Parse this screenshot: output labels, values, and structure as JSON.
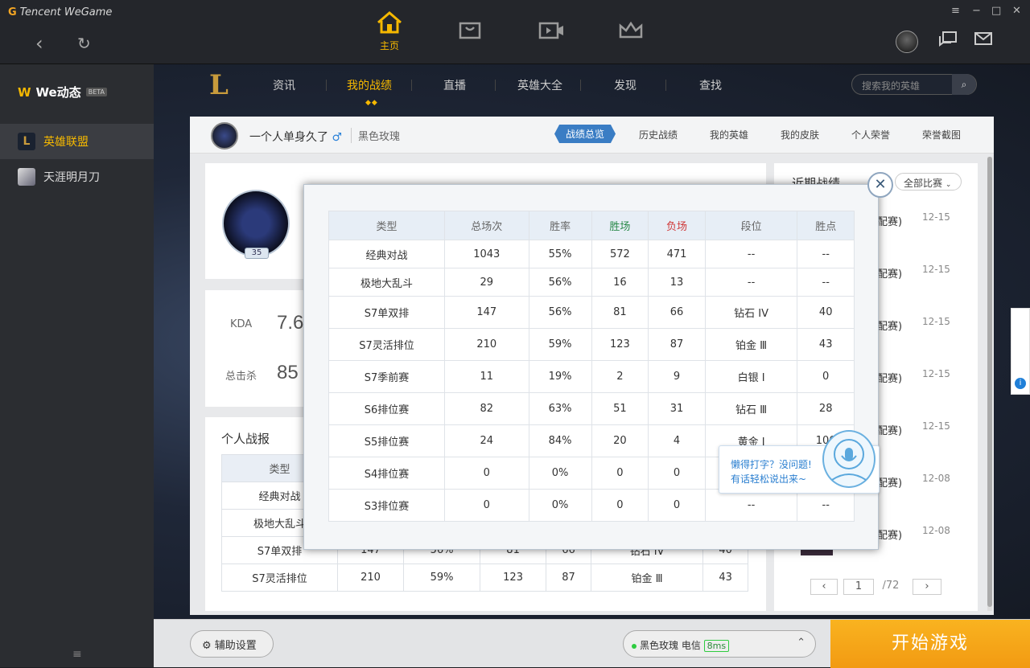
{
  "window": {
    "brand": "Tencent WeGame",
    "controls": [
      "≡",
      "−",
      "□",
      "✕"
    ]
  },
  "topnav": {
    "home": "主页"
  },
  "sidebar": {
    "title": "We动态",
    "beta": "BETA",
    "items": [
      {
        "label": "英雄联盟"
      },
      {
        "label": "天涯明月刀"
      }
    ],
    "menu": "≡"
  },
  "lolnav": {
    "items": [
      "资讯",
      "我的战绩",
      "直播",
      "英雄大全",
      "发现",
      "查找"
    ],
    "search_placeholder": "搜索我的英雄"
  },
  "profile": {
    "name": "一个人单身久了",
    "gender": "♂",
    "server": "黑色玫瑰",
    "level": "35",
    "tabs": [
      "战绩总览",
      "历史战绩",
      "我的英雄",
      "我的皮肤",
      "个人荣誉",
      "荣誉截图"
    ]
  },
  "stats": {
    "kda_label": "KDA",
    "kda_value": "7.6",
    "kills_label": "总击杀",
    "kills_value": "85"
  },
  "report": {
    "title": "个人战报",
    "headers": [
      "类型"
    ],
    "rows": [
      {
        "type": "经典对战"
      },
      {
        "type": "极地大乱斗"
      },
      {
        "type": "S7单双排",
        "cells": [
          "147",
          "56%",
          "81",
          "66",
          "钻石 IV",
          "40"
        ]
      },
      {
        "type": "S7灵活排位",
        "cells": [
          "210",
          "59%",
          "123",
          "87",
          "铂金 Ⅲ",
          "43"
        ]
      }
    ]
  },
  "modal": {
    "close": "✕",
    "headers": [
      "类型",
      "总场次",
      "胜率",
      "胜场",
      "负场",
      "段位",
      "胜点"
    ],
    "rows": [
      [
        "经典对战",
        "1043",
        "55%",
        "572",
        "471",
        "--",
        "--"
      ],
      [
        "极地大乱斗",
        "29",
        "56%",
        "16",
        "13",
        "--",
        "--"
      ],
      [
        "S7单双排",
        "147",
        "56%",
        "81",
        "66",
        "钻石 IV",
        "40"
      ],
      [
        "S7灵活排位",
        "210",
        "59%",
        "123",
        "87",
        "铂金 Ⅲ",
        "43"
      ],
      [
        "S7季前赛",
        "11",
        "19%",
        "2",
        "9",
        "白银 Ⅰ",
        "0"
      ],
      [
        "S6排位赛",
        "82",
        "63%",
        "51",
        "31",
        "钻石 Ⅲ",
        "28"
      ],
      [
        "S5排位赛",
        "24",
        "84%",
        "20",
        "4",
        "黄金 Ⅰ",
        "100"
      ],
      [
        "S4排位赛",
        "0",
        "0%",
        "0",
        "0",
        "",
        ""
      ],
      [
        "S3排位赛",
        "0",
        "0%",
        "0",
        "0",
        "--",
        "--"
      ]
    ]
  },
  "recent": {
    "title": "近期战绩",
    "filter": "全部比赛",
    "items": [
      {
        "mode": "配赛)",
        "date": "12-15"
      },
      {
        "mode": "配赛)",
        "date": "12-15"
      },
      {
        "mode": "配赛)",
        "date": "12-15"
      },
      {
        "mode": "配赛)",
        "date": "12-15"
      },
      {
        "mode": "配赛)",
        "date": "12-15"
      },
      {
        "mode": "配赛)",
        "date": "12-08"
      },
      {
        "mode": "配赛)",
        "date": "12-08"
      }
    ],
    "page": "1",
    "total": "/72"
  },
  "helper": {
    "line1": "懒得打字？没问题!",
    "line2": "有话轻松说出来~"
  },
  "bottom": {
    "assist": "辅助设置",
    "server": "黑色玫瑰 电信",
    "ping": "8ms",
    "start": "开始游戏"
  }
}
